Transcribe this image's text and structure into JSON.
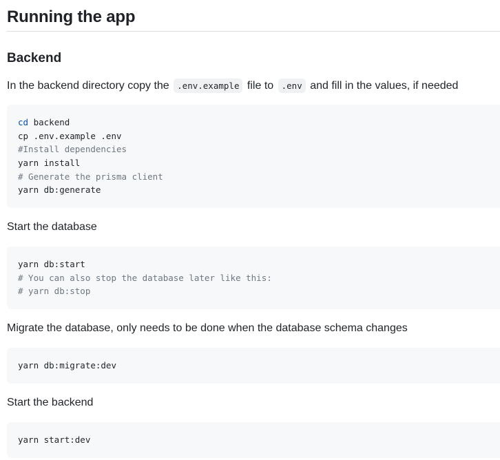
{
  "heading": "Running the app",
  "backend": {
    "heading": "Backend",
    "intro": {
      "text_before": "In the backend directory copy the",
      "code1": ".env.example",
      "text_middle": "file to",
      "code2": ".env",
      "text_after": "and fill in the values, if needed"
    },
    "code_setup": {
      "cd_keyword": "cd",
      "cd_arg": " backend",
      "lines": [
        "cp .env.example .env",
        "#Install dependencies",
        "yarn install",
        "# Generate the prisma client",
        "yarn db:generate"
      ]
    },
    "start_db_text": "Start the database",
    "code_start_db": {
      "lines": [
        "yarn db:start",
        "# You can also stop the database later like this:",
        "# yarn db:stop"
      ]
    },
    "migrate_text": "Migrate the database, only needs to be done when the database schema changes",
    "code_migrate": {
      "lines": [
        "yarn db:migrate:dev"
      ]
    },
    "start_backend_text": "Start the backend",
    "code_start_backend": {
      "lines": [
        "yarn start:dev"
      ]
    }
  }
}
